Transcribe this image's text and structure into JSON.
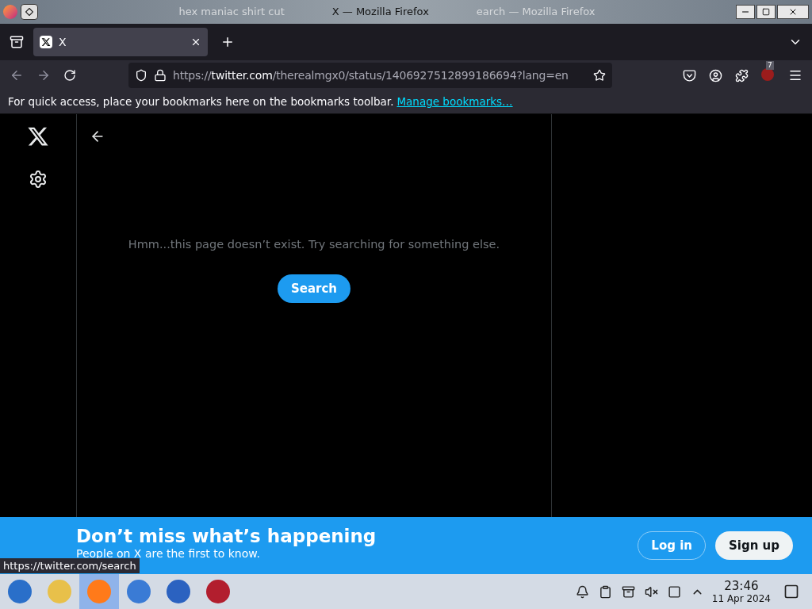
{
  "window": {
    "title": "X — Mozilla Firefox",
    "background_title_parts": [
      "hex maniac shirt cut",
      "earch — Mozilla Firefox"
    ]
  },
  "tabs": [
    {
      "label": "X",
      "selected": true
    }
  ],
  "address_bar": {
    "url_prefix": "https://",
    "url_domain": "twitter.com",
    "url_path": "/therealmgx0/status/1406927512899186694?lang=en"
  },
  "extension_badge": "7",
  "bookmarks_bar": {
    "message": "For quick access, place your bookmarks here on the bookmarks toolbar.",
    "link": "Manage bookmarks…"
  },
  "page": {
    "message": "Hmm...this page doesn’t exist. Try searching for something else.",
    "search_button": "Search"
  },
  "banner": {
    "title": "Don’t miss what’s happening",
    "subtitle": "People on X are the first to know.",
    "login": "Log in",
    "signup": "Sign up"
  },
  "status_tooltip": "https://twitter.com/search",
  "taskbar": {
    "apps": [
      {
        "selected": false
      },
      {
        "selected": false
      },
      {
        "selected": true
      },
      {
        "selected": false
      },
      {
        "selected": false
      },
      {
        "selected": false
      }
    ],
    "time": "23:46",
    "date": "11 Apr 2024"
  }
}
